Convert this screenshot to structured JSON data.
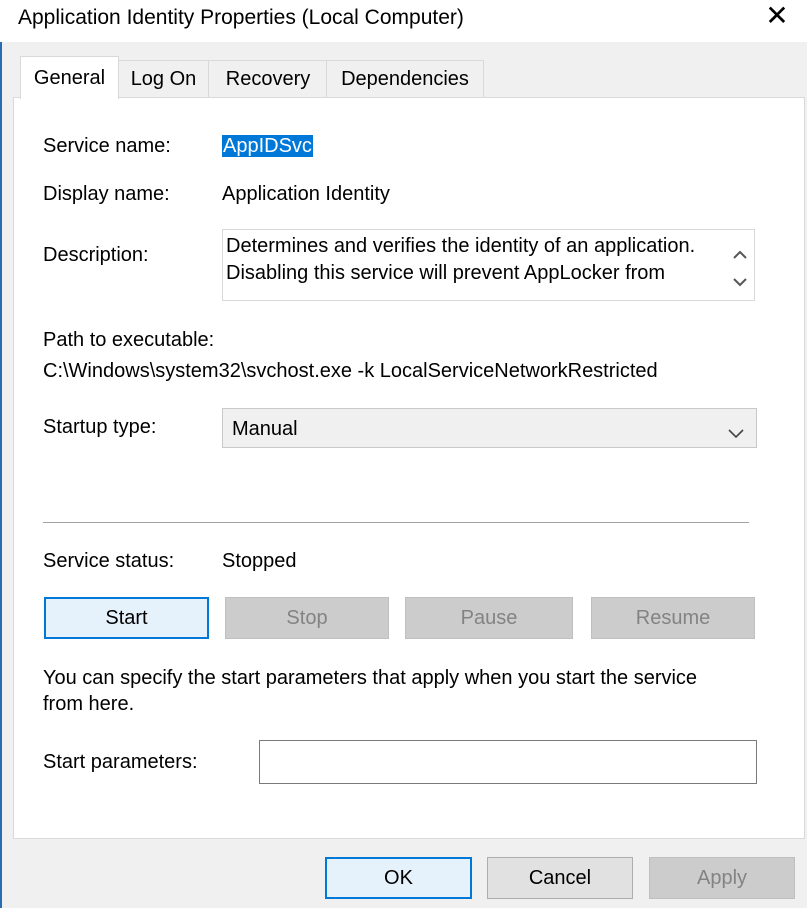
{
  "window": {
    "title": "Application Identity Properties (Local Computer)",
    "close_glyph": "✕"
  },
  "tabs": [
    {
      "label": "General",
      "active": true
    },
    {
      "label": "Log On",
      "active": false
    },
    {
      "label": "Recovery",
      "active": false
    },
    {
      "label": "Dependencies",
      "active": false
    }
  ],
  "general": {
    "service_name_label": "Service name:",
    "service_name_value": "AppIDSvc",
    "display_name_label": "Display name:",
    "display_name_value": "Application Identity",
    "description_label": "Description:",
    "description_line1": "Determines and verifies the identity of an application.",
    "description_line2": "Disabling this service will prevent AppLocker from",
    "path_label": "Path to executable:",
    "path_value": "C:\\Windows\\system32\\svchost.exe -k LocalServiceNetworkRestricted",
    "startup_type_label": "Startup type:",
    "startup_type_value": "Manual",
    "service_status_label": "Service status:",
    "service_status_value": "Stopped",
    "start_label": "Start",
    "stop_label": "Stop",
    "pause_label": "Pause",
    "resume_label": "Resume",
    "hint_line1": "You can specify the start parameters that apply when you start the service",
    "hint_line2": "from here.",
    "start_params_label": "Start parameters:",
    "start_params_value": ""
  },
  "footer": {
    "ok_label": "OK",
    "cancel_label": "Cancel",
    "apply_label": "Apply"
  },
  "icons": {
    "scroll_up": "⌃",
    "scroll_down": "⌄",
    "dropdown": "⌄"
  },
  "colors": {
    "accent": "#0078d7",
    "dialog_bg": "#f0f0f0",
    "panel_bg": "#ffffff",
    "disabled_text": "#838383"
  }
}
